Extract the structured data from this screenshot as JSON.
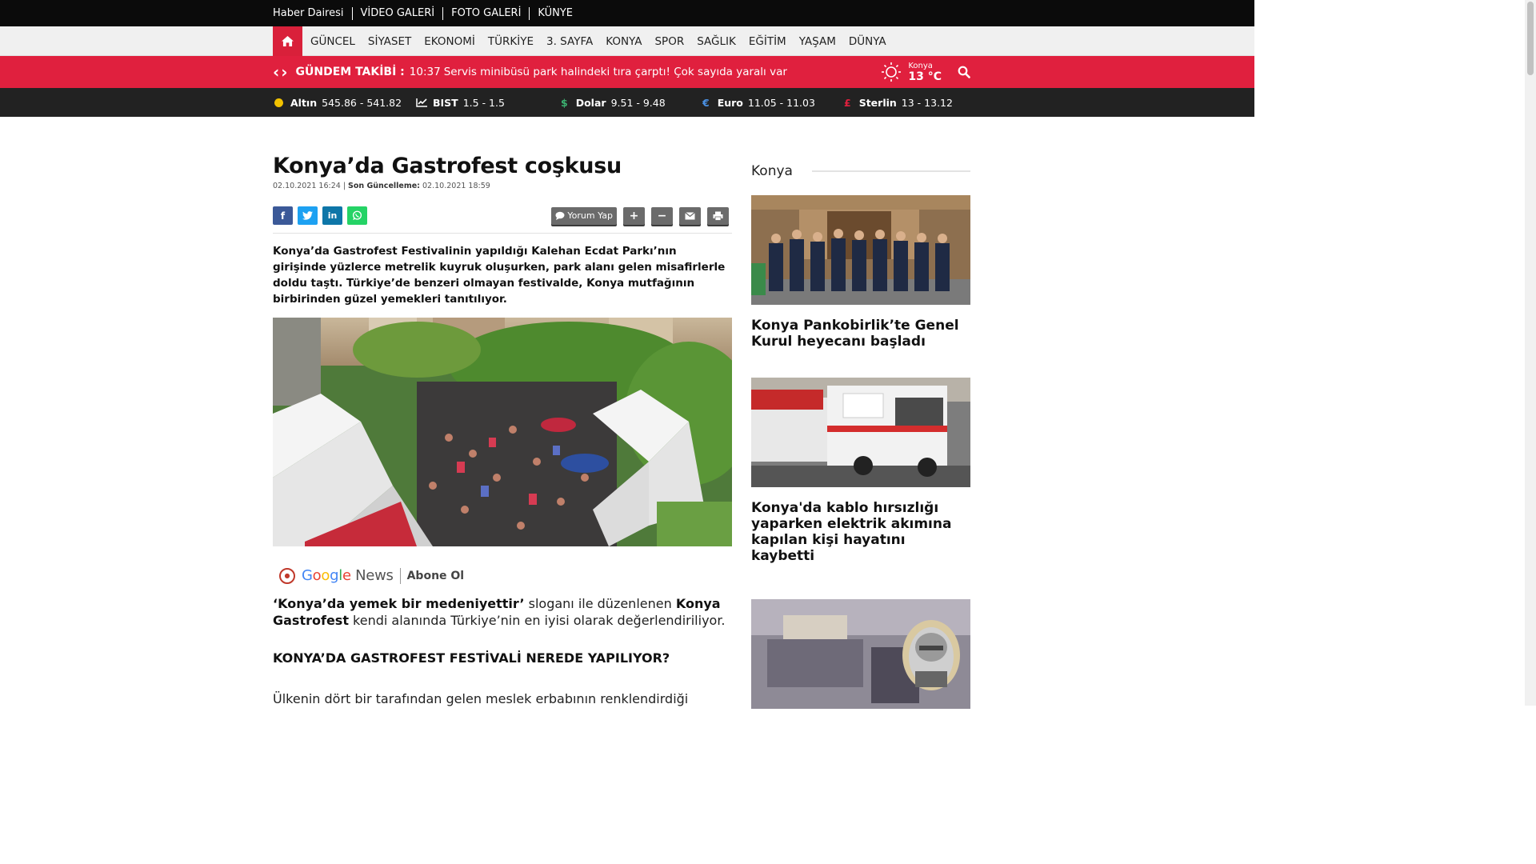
{
  "topbar": {
    "links": [
      "Haber Dairesi",
      "VİDEO GALERİ",
      "FOTO GALERİ",
      "KÜNYE"
    ]
  },
  "nav": {
    "items": [
      "GÜNCEL",
      "SİYASET",
      "EKONOMİ",
      "TÜRKİYE",
      "3. SAYFA",
      "KONYA",
      "SPOR",
      "SAĞLIK",
      "EĞİTİM",
      "YAŞAM",
      "DÜNYA"
    ]
  },
  "ticker": {
    "label": "GÜNDEM TAKİBİ :",
    "time": "10:37",
    "text": "Servis minibüsü park halindeki tıra çarptı! Çok sayıda yaralı var"
  },
  "weather": {
    "city": "Konya",
    "temp": "13 °C"
  },
  "market": [
    {
      "name": "Altın",
      "value": "545.86 - 541.82",
      "icon": "gold-coin-icon",
      "color": "#f2c200"
    },
    {
      "name": "BIST",
      "value": "1.5 - 1.5",
      "icon": "chart-line-icon",
      "color": "#ffffff"
    },
    {
      "name": "Dolar",
      "value": "9.51 - 9.48",
      "icon": "dollar-icon",
      "color": "#3cb371"
    },
    {
      "name": "Euro",
      "value": "11.05 - 11.03",
      "icon": "euro-icon",
      "color": "#4a90e2"
    },
    {
      "name": "Sterlin",
      "value": "13 - 13.12",
      "icon": "pound-icon",
      "color": "#e0203e"
    }
  ],
  "article": {
    "title": "Konya’da Gastrofest coşkusu",
    "date": "02.10.2021 16:24",
    "updated_label": "Son Güncelleme:",
    "updated": "02.10.2021 18:59",
    "comment_label": "Yorum Yap",
    "spot": "Konya’da Gastrofest Festivalinin yapıldığı Kalehan Ecdat Parkı’nın girişinde yüzlerce metrelik kuyruk oluşurken, park alanı gelen misafirlerle doldu taştı. Türkiye’de benzeri olmayan festivalde, Konya mutfağının birbirinden güzel yemekleri tanıtılıyor.",
    "gnews_label": "Google News",
    "abone_label": "Abone Ol",
    "p1_a": "‘Konya’da yemek bir medeniyettir’",
    "p1_b": " sloganı ile düzenlenen ",
    "p1_c": "Konya Gastrofest",
    "p1_d": " kendi alanında Türkiye’nin en iyisi olarak değerlendiriliyor.",
    "h2": "KONYA’DA GASTROFEST FESTİVALİ NEREDE YAPILIYOR?",
    "p2": "Ülkenin dört bir tarafından gelen meslek erbabının renklendirdiği"
  },
  "sidebar": {
    "category": "Konya",
    "news": [
      {
        "title": "Konya Pankobirlik’te Genel Kurul heyecanı başladı"
      },
      {
        "title": "Konya'da kablo hırsızlığı yaparken elektrik akımına kapılan kişi hayatını kaybetti"
      },
      {
        "title": ""
      }
    ]
  },
  "colors": {
    "accent": "#e0203e",
    "topbar": "#0b0b0b",
    "market": "#222222"
  }
}
